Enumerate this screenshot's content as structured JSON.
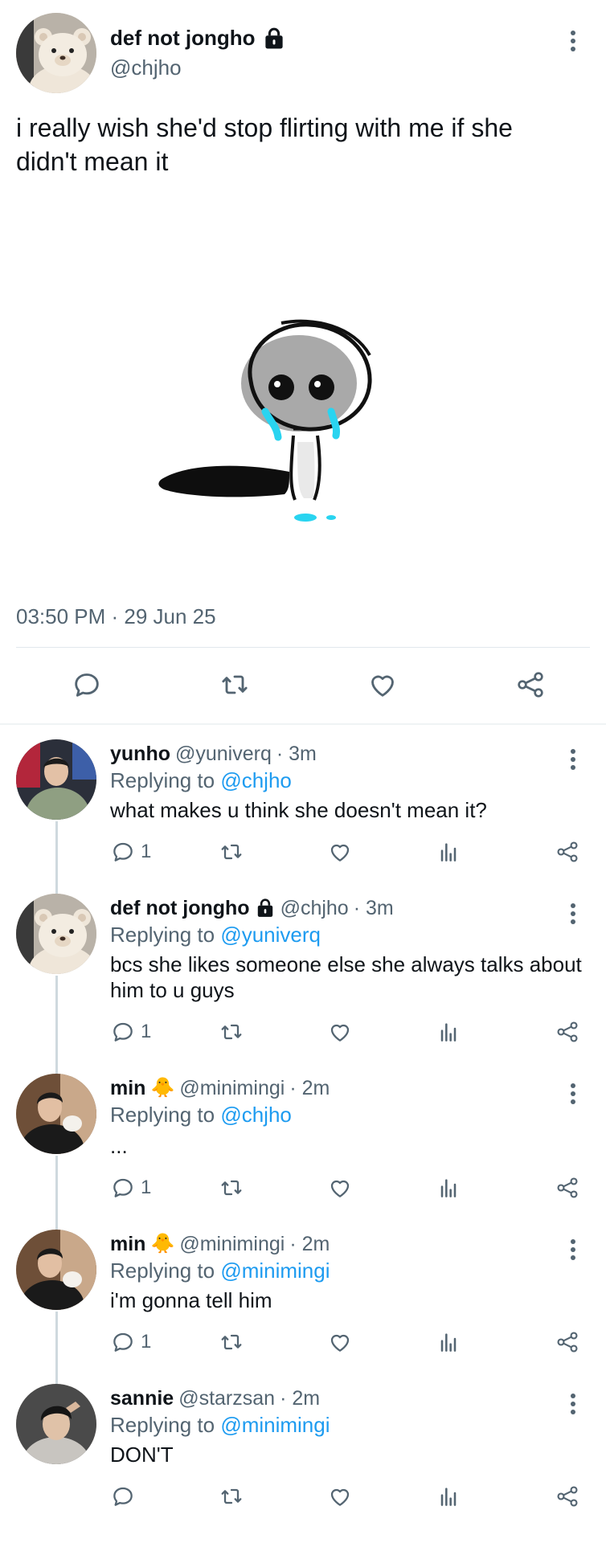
{
  "tweet": {
    "name": "def not jongho",
    "handle": "@chjho",
    "text": "i really wish she'd stop flirting with me if she didn't mean it",
    "timestamp": "03:50 PM · 29 Jun 25"
  },
  "replies": [
    {
      "name": "yunho",
      "handle": "@yuniverq",
      "time": "· 3m",
      "replying_prefix": "Replying to",
      "replying_to": "@chjho",
      "text": "what makes u think she doesn't mean it?",
      "reply_count": "1"
    },
    {
      "name": "def not jongho",
      "handle": "@chjho",
      "time": "· 3m",
      "replying_prefix": "Replying to",
      "replying_to": "@yuniverq",
      "text": "bcs she likes someone else she always talks about him to u guys",
      "reply_count": "1"
    },
    {
      "name": "min",
      "emoji": "🐥",
      "handle": "@minimingi",
      "time": "· 2m",
      "replying_prefix": "Replying to",
      "replying_to": "@chjho",
      "text": "...",
      "reply_count": "1"
    },
    {
      "name": "min",
      "emoji": "🐥",
      "handle": "@minimingi",
      "time": "· 2m",
      "replying_prefix": "Replying to",
      "replying_to": "@minimingi",
      "text": "i'm gonna tell him",
      "reply_count": "1"
    },
    {
      "name": "sannie",
      "handle": "@starzsan",
      "time": "· 2m",
      "replying_prefix": "Replying to",
      "replying_to": "@minimingi",
      "text": "DON'T",
      "reply_count": ""
    }
  ],
  "icons": {
    "reply": "reply-icon",
    "retweet": "retweet-icon",
    "like": "heart-icon",
    "views": "views-icon",
    "share": "share-icon",
    "lock": "lock-icon",
    "more": "more-icon"
  },
  "colors": {
    "link": "#1d9bf0",
    "secondary": "#536471",
    "tear": "#29d4f0"
  }
}
